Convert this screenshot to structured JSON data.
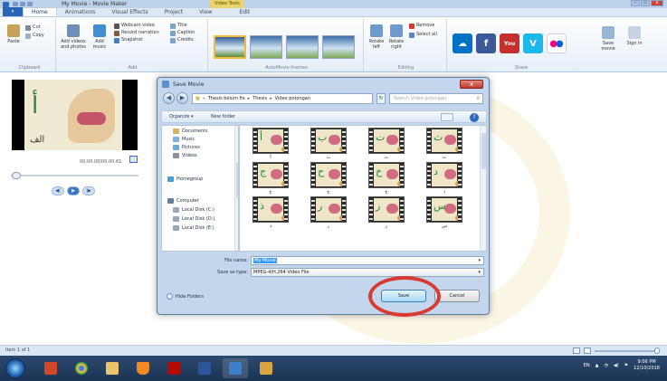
{
  "window": {
    "title": "My Movie - Movie Maker",
    "context_tab": "Video Tools",
    "win_buttons": [
      "–",
      "▫",
      "x"
    ]
  },
  "tabs": {
    "file": "▾",
    "items": [
      "Home",
      "Animations",
      "Visual Effects",
      "Project",
      "View",
      "Edit"
    ]
  },
  "ribbon": {
    "clipboard": {
      "paste": "Paste",
      "cut": "Cut",
      "copy": "Copy",
      "label": "Clipboard"
    },
    "add": {
      "add_videos": "Add videos and photos",
      "add_music": "Add music",
      "webcam": "Webcam video",
      "narration": "Record narration",
      "snapshot": "Snapshot",
      "title": "Title",
      "caption": "Caption",
      "credits": "Credits",
      "label": "Add"
    },
    "themes_label": "AutoMovie themes",
    "editing": {
      "rotate_left": "Rotate left",
      "rotate_right": "Rotate right",
      "remove": "Remove",
      "select_all": "Select all",
      "label": "Editing"
    },
    "share": {
      "label": "Share",
      "save_movie": "Save movie",
      "sign_in": "Sign in"
    }
  },
  "preview": {
    "letter": "أ",
    "caption": "الف",
    "timecode": "00:00.00/00:00.61"
  },
  "dialog": {
    "title": "Save Movie",
    "close": "x",
    "address": [
      "Thesis belum fix",
      "Thesis",
      "Video potongan"
    ],
    "search_placeholder": "Search Video potongan",
    "organize": "Organize ▾",
    "new_folder": "New folder",
    "nav": [
      {
        "label": "Documents",
        "color": "#d9b45a"
      },
      {
        "label": "Music",
        "color": "#7bb0e0"
      },
      {
        "label": "Pictures",
        "color": "#6fa9d8"
      },
      {
        "label": "Videos",
        "color": "#8a8f99"
      },
      {
        "label": "Homegroup",
        "color": "#4c9ad6"
      },
      {
        "label": "Computer",
        "color": "#5f7fa6"
      },
      {
        "label": "Local Disk (C:)",
        "color": "#9aa7b8"
      },
      {
        "label": "Local Disk (D:)",
        "color": "#9aa7b8"
      },
      {
        "label": "Local Disk (E:)",
        "color": "#9aa7b8"
      }
    ],
    "files": [
      {
        "letter": "أ",
        "label": "أ"
      },
      {
        "letter": "ب",
        "label": "ب"
      },
      {
        "letter": "ت",
        "label": "ت"
      },
      {
        "letter": "ث",
        "label": "ث"
      },
      {
        "letter": "ج",
        "label": "ج"
      },
      {
        "letter": "ح",
        "label": "ح"
      },
      {
        "letter": "خ",
        "label": "خ"
      },
      {
        "letter": "د",
        "label": "د"
      },
      {
        "letter": "ذ",
        "label": "ذ"
      },
      {
        "letter": "ر",
        "label": "ر"
      },
      {
        "letter": "ز",
        "label": "ز"
      },
      {
        "letter": "س",
        "label": "س"
      }
    ],
    "file_name_label": "File name:",
    "file_name_value": "My Movie",
    "save_as_label": "Save as type:",
    "save_as_value": "MPEG-4/H.264 Video File",
    "hide_folders": "Hide Folders",
    "save": "Save",
    "cancel": "Cancel"
  },
  "status": {
    "item_count": "Item 1 of 1"
  },
  "tray": {
    "lang": "EN",
    "time": "9:06 PM",
    "date": "12/10/2018"
  },
  "colors": {
    "accent": "#2a64b4",
    "highlight": "#d63a32"
  }
}
